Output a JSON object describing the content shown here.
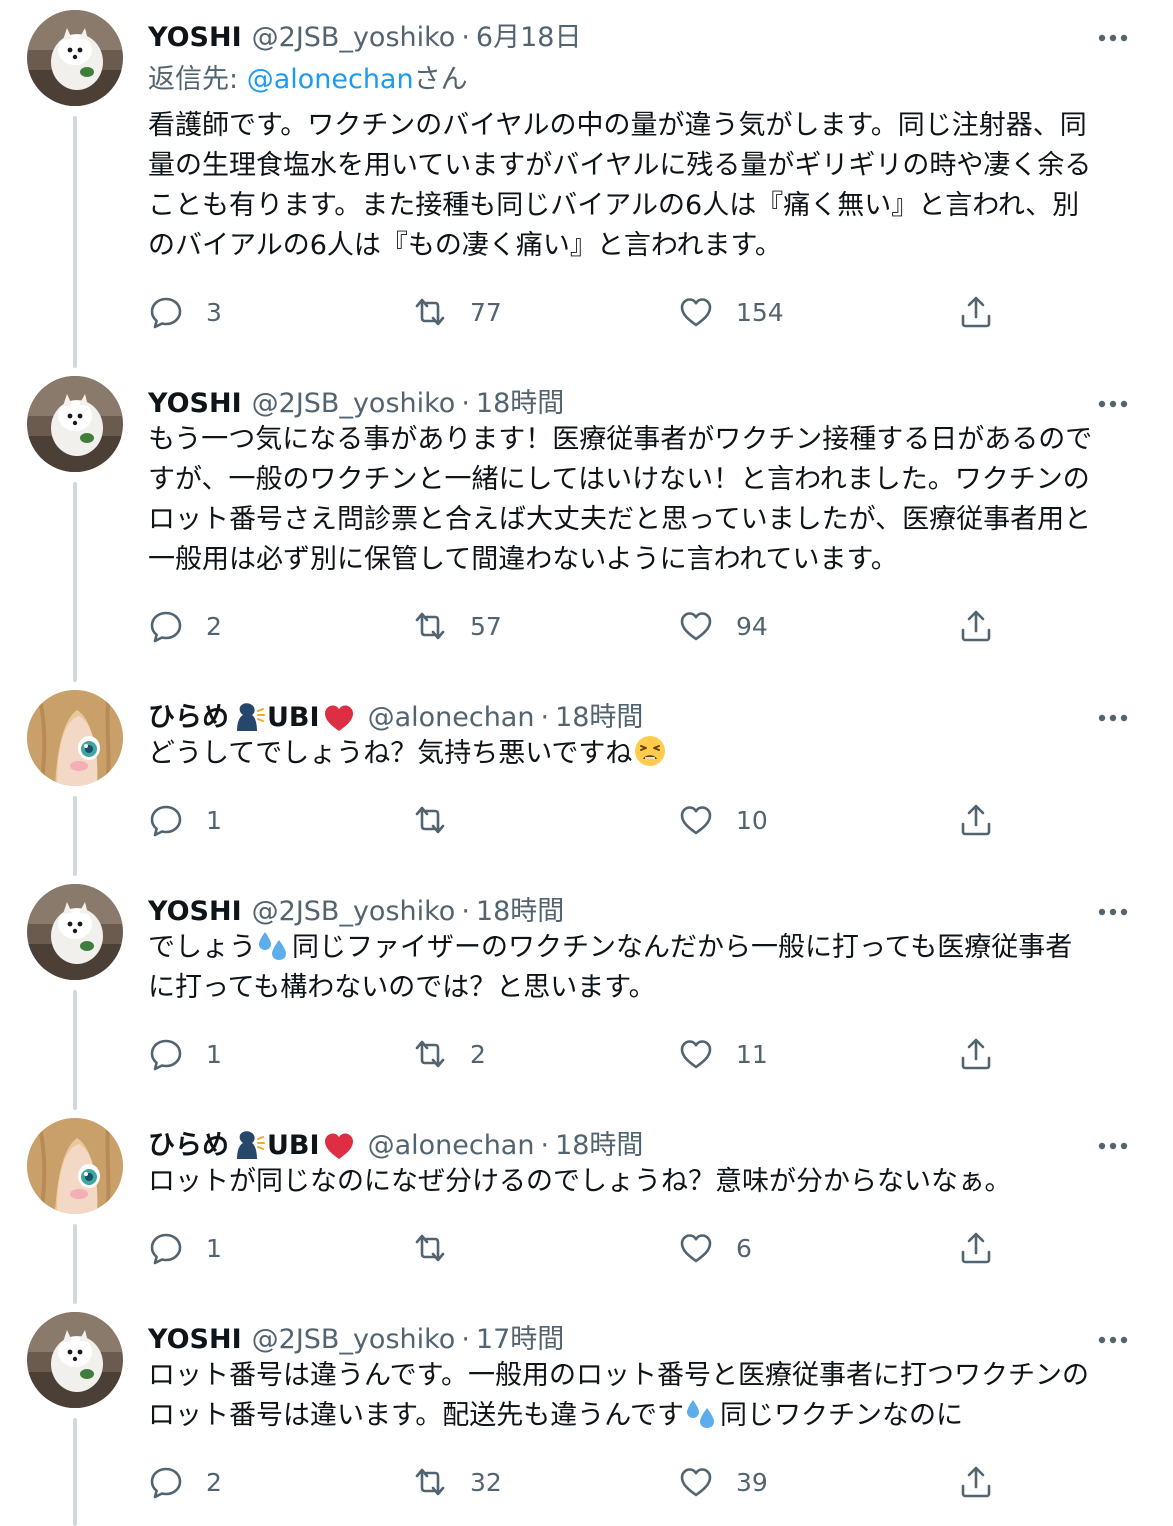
{
  "tweets": [
    {
      "author_name": "YOSHI",
      "handle": "@2JSB_yoshiko",
      "time": "6月18日",
      "avatar_icon": "pomeranian-avatar",
      "reply_to_prefix": "返信先: ",
      "reply_to_handle": "@alonechan",
      "reply_to_suffix": "さん",
      "lines": [
        "看護師です。ワクチンのバイヤルの中の量が違う気がします。同じ注射器、同",
        "量の生理食塩水を用いていますがバイヤルに残る量がギリギリの時や凄く余る",
        "ことも有ります。また接種も同じバイアルの6人は『痛く無い』と言われ、別",
        "のバイアルの6人は『もの凄く痛い』と言われます。"
      ],
      "replies": "3",
      "retweets": "77",
      "likes": "154"
    },
    {
      "author_name": "YOSHI",
      "handle": "@2JSB_yoshiko",
      "time": "18時間",
      "avatar_icon": "pomeranian-avatar",
      "lines": [
        "もう一つ気になる事があります！医療従事者がワクチン接種する日があるので",
        "すが、一般のワクチンと一緒にしてはいけない！と言われました。ワクチンの",
        "ロット番号さえ問診票と合えば大丈夫だと思っていましたが、医療従事者用と",
        "一般用は必ず別に保管して間違わないように言われています。"
      ],
      "replies": "2",
      "retweets": "57",
      "likes": "94"
    },
    {
      "author_name": "ひらめ",
      "author_name_suffix": "UBI",
      "handle": "@alonechan",
      "time": "18時間",
      "avatar_icon": "anime-girl-avatar",
      "name_emojis": [
        "speaking-head-icon",
        "red-heart-icon"
      ],
      "line_a": "どうしてでしょうね？気持ち悪いですね",
      "line_a_emoji": "tired-face-icon",
      "replies": "1",
      "retweets": "",
      "likes": "10"
    },
    {
      "author_name": "YOSHI",
      "handle": "@2JSB_yoshiko",
      "time": "18時間",
      "avatar_icon": "pomeranian-avatar",
      "line_a_pre": "でしょう",
      "line_a_emoji": "sweat-droplets-icon",
      "line_a_post": "同じファイザーのワクチンなんだから一般に打っても医療従事者",
      "line_b": "に打っても構わないのでは？と思います。",
      "replies": "1",
      "retweets": "2",
      "likes": "11"
    },
    {
      "author_name": "ひらめ",
      "author_name_suffix": "UBI",
      "handle": "@alonechan",
      "time": "18時間",
      "avatar_icon": "anime-girl-avatar",
      "name_emojis": [
        "speaking-head-icon",
        "red-heart-icon"
      ],
      "line_a": "ロットが同じなのになぜ分けるのでしょうね？意味が分からないなぁ。",
      "replies": "1",
      "retweets": "",
      "likes": "6"
    },
    {
      "author_name": "YOSHI",
      "handle": "@2JSB_yoshiko",
      "time": "17時間",
      "avatar_icon": "pomeranian-avatar",
      "line_a": "ロット番号は違うんです。一般用のロット番号と医療従事者に打つワクチンの",
      "line_b_pre": "ロット番号は違います。配送先も違うんです",
      "line_b_emoji": "sweat-droplets-icon",
      "line_b_post": "同じワクチンなのに",
      "replies": "2",
      "retweets": "32",
      "likes": "39"
    }
  ],
  "separator": "·",
  "colors": {
    "text": "#0f1419",
    "secondary": "#536471",
    "link": "#1d9bf0",
    "thread_line": "#cfd9de"
  }
}
